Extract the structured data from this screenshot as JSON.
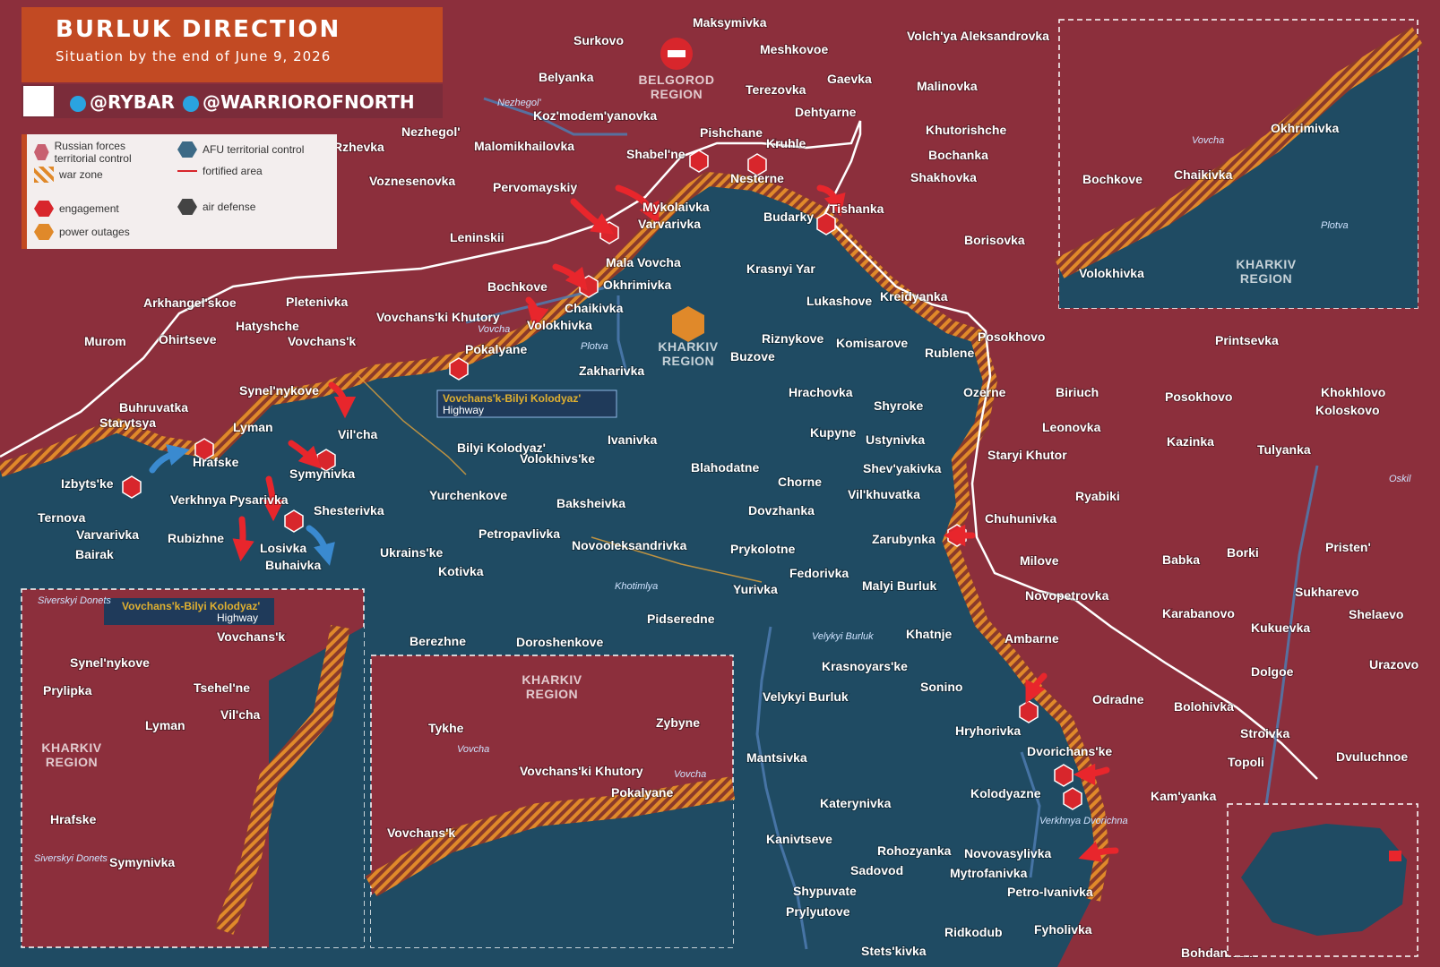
{
  "header": {
    "title": "BURLUK DIRECTION",
    "subtitle": "Situation by the end of June 9, 2026",
    "channel_1": "@RYBAR",
    "channel_2": "@WARRIOROFNORTH"
  },
  "legend": {
    "russian_forces": "Russian forces territorial control",
    "afu": "AFU territorial control",
    "war_zone": "war zone",
    "fortified_area": "fortified area",
    "engagement": "engagement",
    "air_defense": "air defense",
    "power_outages": "power outages"
  },
  "colors": {
    "russian": "#8c2f3c",
    "afu": "#1f4b63",
    "war_zone": "#e0892a",
    "engagement": "#d8262c",
    "header": "#c24a23"
  },
  "regions": {
    "belgorod": [
      "BELGOROD",
      "REGION"
    ],
    "kharkiv": [
      "KHARKIV",
      "REGION"
    ]
  },
  "rivers": [
    "Nezhegol'",
    "Vovcha",
    "Plotva",
    "Khotimlya",
    "Velykyi Burluk",
    "Verkhnya Dvorichna",
    "Oskil",
    "Siverskyi Donets"
  ],
  "highway_label": [
    "Vovchans'k-Bilyi Kolodyaz'",
    "Highway"
  ],
  "places": {
    "russian_side": [
      "Maksymivka",
      "Surkovo",
      "Belyanka",
      "Meshkovoe",
      "Volch'ya Aleksandrovka",
      "Gaevka",
      "Malinovka",
      "Terezovka",
      "Nezhegol'",
      "Koz'modem'yanovka",
      "Malomikhailovka",
      "Rzhevka",
      "Voznesenovka",
      "Pishchane",
      "Kruhle",
      "Dehtyarne",
      "Khutorishche",
      "Bochanka",
      "Shakhovka",
      "Shabel'ne",
      "Nesterne",
      "Pervomayskiy",
      "Mykolaivka",
      "Varvarivka",
      "Budarky",
      "Tishanka",
      "Leninskii",
      "Borisovka",
      "Bochkove",
      "Okhrimivka",
      "Chaikivka",
      "Volokhivka",
      "Arkhangel'skoe",
      "Pletenivka",
      "Hatyshche",
      "Murom",
      "Ohirtseve",
      "Vovchans'k",
      "Vovchans'ki Khutory",
      "Pokalyane",
      "Kreidyanka",
      "Posokhovo",
      "Printsevka",
      "Synel'nykove",
      "Vil'cha",
      "Lyman",
      "Buhruvatka",
      "Starytsya",
      "Hrafske",
      "Symynivka",
      "Izbyts'ke",
      "Biriuch",
      "Posokhovo",
      "Khokhlovo",
      "Koloskovo",
      "Leonovka",
      "Kazinka",
      "Tulyanka",
      "Ryabiki",
      "Babka",
      "Borki",
      "Pristen'",
      "Sukharevo",
      "Shelaevo",
      "Karabanovo",
      "Kukuevka",
      "Dolgoe",
      "Urazovo",
      "Bolohivka",
      "Stroivka",
      "Topoli",
      "Dvuluchnoe",
      "Kam'yanka",
      "Bohdanivske",
      "Staryi Khutor"
    ],
    "afu_side": [
      "Mala Vovcha",
      "Krasnyi Yar",
      "Lukashove",
      "Riznykove",
      "Komisarove",
      "Rublene",
      "Buzove",
      "Zakharivka",
      "Hrachovka",
      "Shyroke",
      "Ozerne",
      "Kupyne",
      "Ustynivka",
      "Ivanivka",
      "Bilyi Kolodyaz'",
      "Volokhivs'ke",
      "Blahodatne",
      "Shev'yakivka",
      "Chorne",
      "Vil'khuvatka",
      "Yurchenkove",
      "Baksheivka",
      "Dovzhanka",
      "Chuhunivka",
      "Zarubynka",
      "Verkhnya Pysarivka",
      "Shesterivka",
      "Ternova",
      "Varvarivka",
      "Bairak",
      "Rubizhne",
      "Losivka",
      "Buhaivka",
      "Ukrains'ke",
      "Petropavlivka",
      "Novooleksandrivka",
      "Prykolotne",
      "Kotivka",
      "Fedorivka",
      "Yurivka",
      "Malyi Burluk",
      "Milove",
      "Novopetrovka",
      "Pidseredne",
      "Khatnje",
      "Ambarne",
      "Berezhne",
      "Doroshenkove",
      "Krasnoyars'ke",
      "Sonino",
      "Velykyi Burluk",
      "Odradne",
      "Hryhorivka",
      "Mantsivka",
      "Dvorichans'ke",
      "Kolodyazne",
      "Katerynivka",
      "Kanivtseve",
      "Rohozyanka",
      "Novovasylivka",
      "Sadovod",
      "Mytrofanivka",
      "Shypuvate",
      "Petro-Ivanivka",
      "Prylyutove",
      "Ridkodub",
      "Fyholivka",
      "Stets'kivka"
    ]
  },
  "inset_ne": {
    "places": [
      "Okhrimivka",
      "Bochkove",
      "Chaikivka",
      "Volokhivka"
    ],
    "rivers": [
      "Vovcha",
      "Plotva"
    ],
    "region": [
      "KHARKIV",
      "REGION"
    ]
  },
  "inset_sw": {
    "places": [
      "Vovchans'k",
      "Synel'nykove",
      "Prylipka",
      "Tsehel'ne",
      "Vil'cha",
      "Lyman",
      "Hrafske",
      "Symynivka"
    ],
    "rivers": [
      "Siverskyi Donets",
      "Siverskyi Donets"
    ],
    "region": [
      "KHARKIV",
      "REGION"
    ],
    "highway": [
      "Vovchans'k-Bilyi Kolodyaz'",
      "Highway"
    ]
  },
  "inset_mid": {
    "places": [
      "Tykhe",
      "Zybyne",
      "Vovchans'ki Khutory",
      "Pokalyane",
      "Vovchans'k"
    ],
    "rivers": [
      "Vovcha",
      "Vovcha"
    ],
    "region": [
      "KHARKIV",
      "REGION"
    ]
  }
}
